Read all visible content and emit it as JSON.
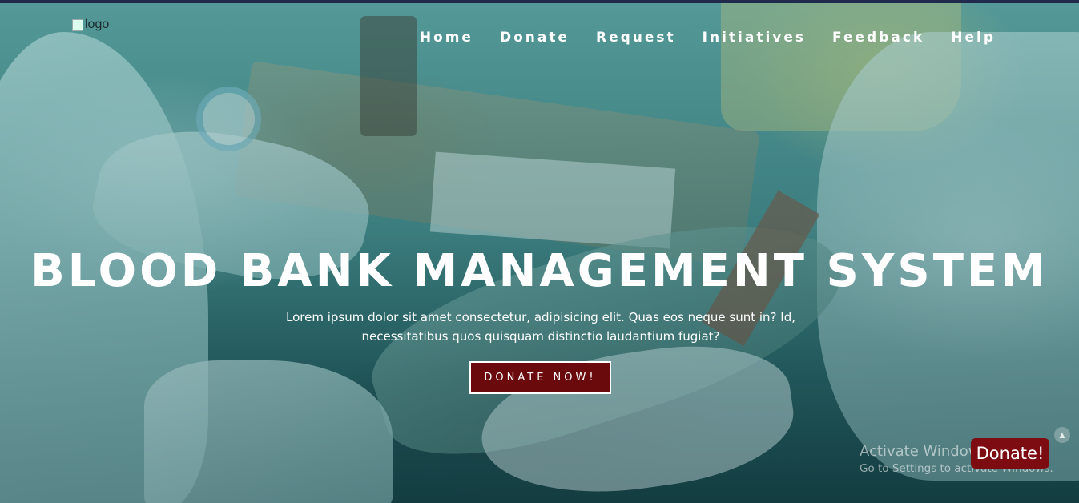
{
  "header": {
    "logo_alt": "logo",
    "nav": [
      {
        "label": "Home"
      },
      {
        "label": "Donate"
      },
      {
        "label": "Request"
      },
      {
        "label": "Initiatives"
      },
      {
        "label": "Feedback"
      },
      {
        "label": "Help"
      }
    ]
  },
  "hero": {
    "title": "BLOOD BANK MANAGEMENT SYSTEM",
    "subtitle_line1": "Lorem ipsum dolor sit amet consectetur, adipisicing elit. Quas eos neque sunt in? Id,",
    "subtitle_line2": "necessitatibus quos quisquam distinctio laudantium fugiat?",
    "cta_label": "DONATE NOW!"
  },
  "floating": {
    "donate_label": "Donate!",
    "scroll_icon": "chevron-up-icon"
  },
  "watermark": {
    "line1": "Activate Windows",
    "line2": "Go to Settings to activate Windows."
  },
  "colors": {
    "cta_bg": "#6b0a0c",
    "float_bg": "#7d0c12",
    "top_stripe": "#1f2a4d"
  }
}
